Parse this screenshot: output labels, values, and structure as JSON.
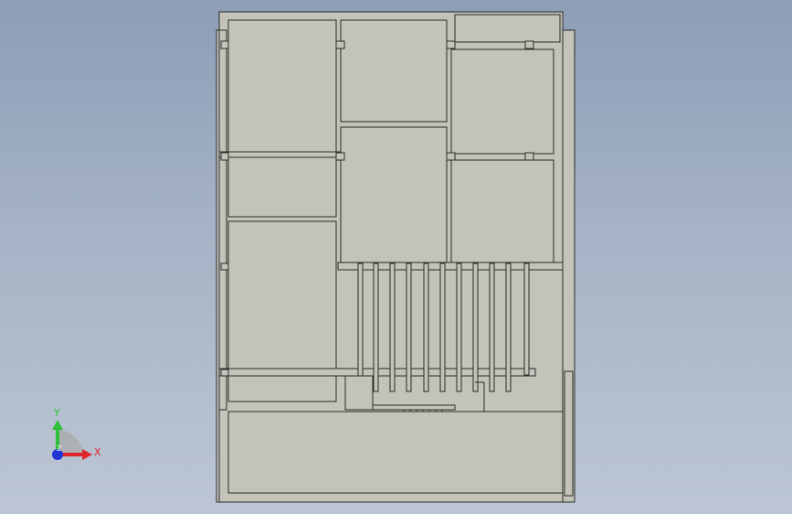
{
  "viewport": {
    "background_top": "#8d9db6",
    "background_bottom": "#bcc6d4"
  },
  "model": {
    "face_color": "#c3c3b9",
    "edge_color": "#2b2b2b"
  },
  "triad": {
    "x_label": "X",
    "y_label": "Y",
    "z_label": "Z",
    "x_color": "#e0262a",
    "y_color": "#2fbf3a",
    "z_color": "#2236d6"
  }
}
